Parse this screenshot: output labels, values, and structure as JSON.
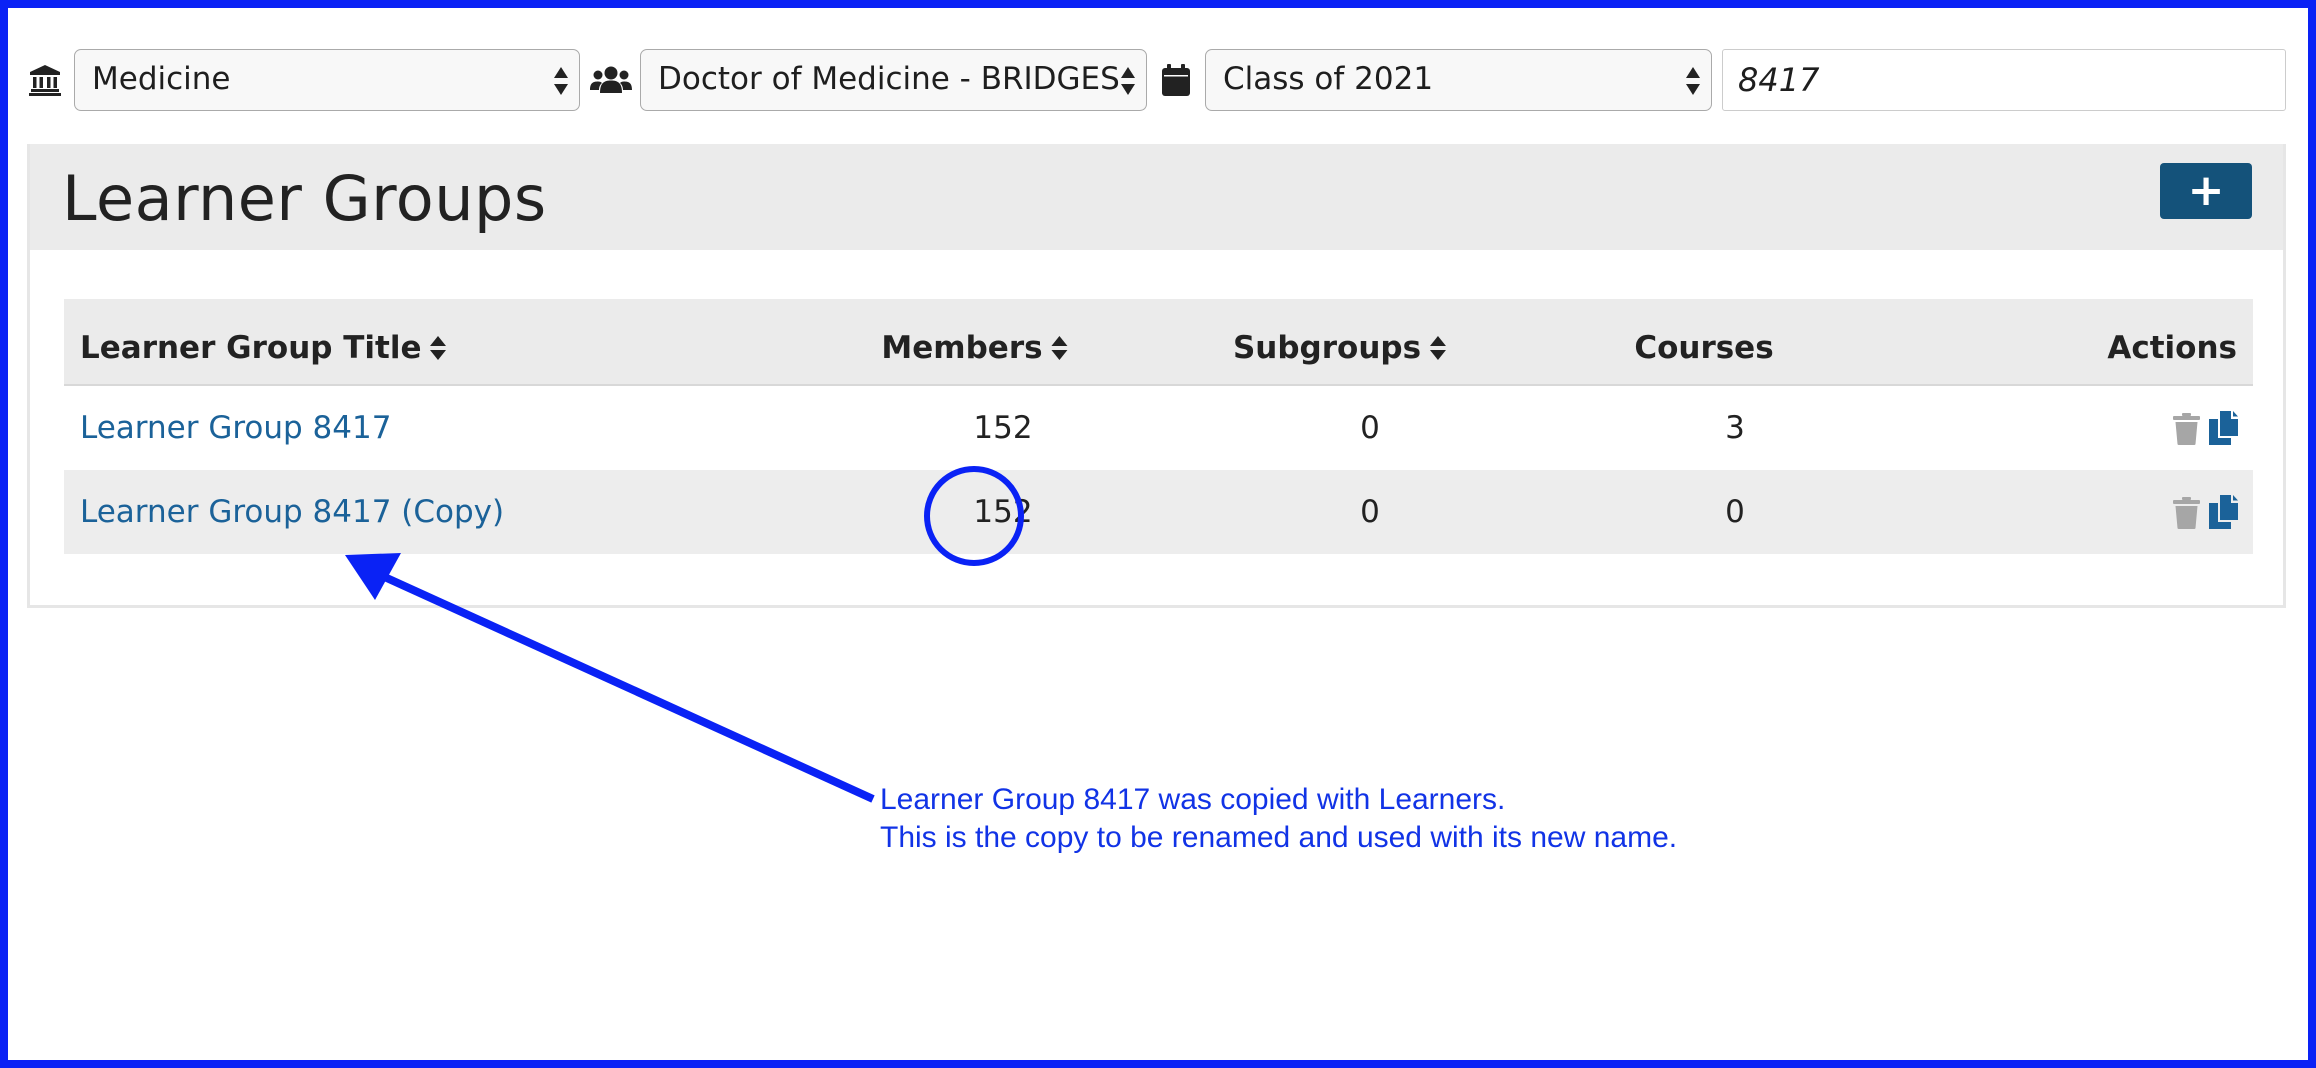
{
  "filters": {
    "school": {
      "icon": "university-icon",
      "value": "Medicine"
    },
    "program": {
      "icon": "users-icon",
      "value": "Doctor of Medicine - BRIDGES"
    },
    "cohort": {
      "icon": "calendar-icon",
      "value": "Class of 2021"
    },
    "search": {
      "value": "8417"
    }
  },
  "page": {
    "title": "Learner Groups",
    "add_button_label": "+",
    "add_button_icon": "plus-icon"
  },
  "table": {
    "columns": {
      "title": "Learner Group Title",
      "members": "Members",
      "subgroups": "Subgroups",
      "courses": "Courses",
      "actions": "Actions"
    },
    "rows": [
      {
        "title": "Learner Group 8417",
        "members": "152",
        "subgroups": "0",
        "courses": "3",
        "actions": [
          "trash-icon",
          "copy-icon"
        ]
      },
      {
        "title": "Learner Group 8417 (Copy)",
        "members": "152",
        "subgroups": "0",
        "courses": "0",
        "actions": [
          "trash-icon",
          "copy-icon"
        ]
      }
    ]
  },
  "annotation": {
    "line1": "Learner Group 8417 was copied with Learners.",
    "line2": "This is the copy to be renamed and used with its new name.",
    "color": "#1133e6"
  },
  "colors": {
    "frame": "#0a22f5",
    "link": "#1b6299",
    "primary_button": "#14527a",
    "header_band": "#ebebeb",
    "disabled_icon": "#a6a6a6"
  }
}
